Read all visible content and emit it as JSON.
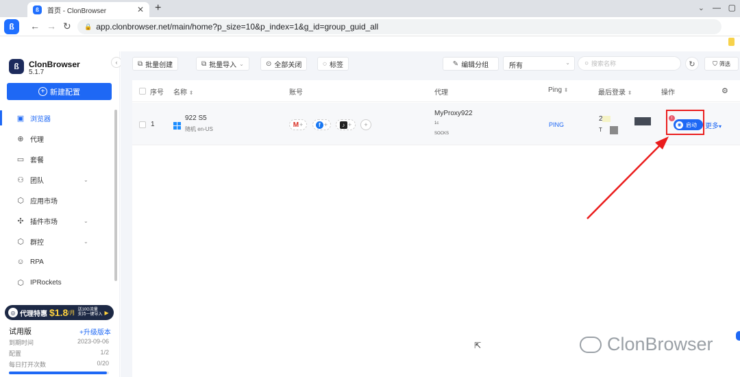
{
  "browser": {
    "tab_title": "首页 - ClonBrowser",
    "url": "app.clonbrowser.net/main/home?p_size=10&p_index=1&g_id=group_guid_all"
  },
  "brand": {
    "name": "ClonBrowser",
    "version": "5.1.7"
  },
  "sidebar": {
    "new_config": "新建配置",
    "items": [
      {
        "label": "浏览器",
        "icon": "browser-icon",
        "active": true,
        "expand": false
      },
      {
        "label": "代理",
        "icon": "globe-icon",
        "active": false,
        "expand": false
      },
      {
        "label": "套餐",
        "icon": "package-icon",
        "active": false,
        "expand": false
      },
      {
        "label": "团队",
        "icon": "team-icon",
        "active": false,
        "expand": true
      },
      {
        "label": "应用市场",
        "icon": "app-market-icon",
        "active": false,
        "expand": false
      },
      {
        "label": "插件市场",
        "icon": "plugin-icon",
        "active": false,
        "expand": true
      },
      {
        "label": "群控",
        "icon": "group-control-icon",
        "active": false,
        "expand": true
      },
      {
        "label": "RPA",
        "icon": "robot-icon",
        "active": false,
        "expand": false
      },
      {
        "label": "IPRockets",
        "icon": "rocket-icon",
        "active": false,
        "expand": false
      }
    ],
    "promo": {
      "text": "代理特惠",
      "price": "$1.8",
      "unit": "/月",
      "line1": "送10G流量",
      "line2": "支持一键导入"
    },
    "plan": {
      "name": "试用版",
      "upgrade": "+升级版本",
      "expire_label": "到期时间",
      "expire_value": "2023-09-06",
      "config_label": "配置",
      "config_value": "1/2",
      "daily_label": "每日打开次数",
      "daily_value": "0/20",
      "daily_progress": 0.98
    }
  },
  "toolbar": {
    "batch_create": "批量创建",
    "batch_import": "批量导入",
    "close_all": "全部关闭",
    "tags": "标签",
    "edit_group": "编辑分组",
    "group_select": "所有",
    "search_placeholder": "搜索名称",
    "filter": "筛选"
  },
  "table": {
    "headers": {
      "no": "序号",
      "name": "名称",
      "account": "账号",
      "proxy": "代理",
      "ping": "Ping",
      "last_login": "最后登录",
      "action": "操作"
    },
    "rows": [
      {
        "no": "1",
        "name": "922 S5",
        "sub": "随机 en-US",
        "proxy_name": "MyProxy922",
        "proxy_ip": "1c",
        "proxy_type": "SOCKS",
        "ping": "PING",
        "login_a": "2",
        "login_b": "T",
        "start": "启动",
        "more": "更多"
      }
    ]
  },
  "watermark": "ClonBrowser",
  "colors": {
    "accent": "#1e68f5",
    "annotation": "#ea1c1c"
  }
}
